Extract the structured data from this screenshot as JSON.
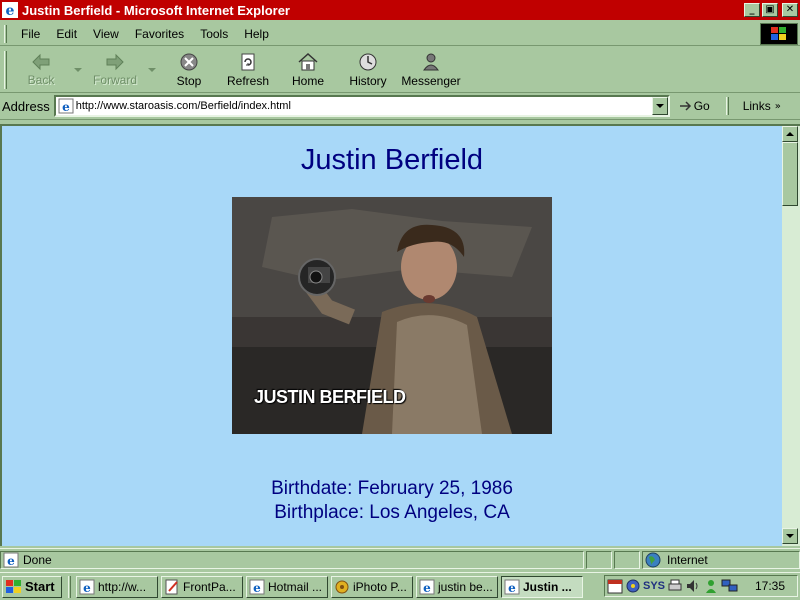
{
  "window": {
    "title": "Justin Berfield - Microsoft Internet Explorer",
    "controls": {
      "minimize": "_",
      "maximize": "▣",
      "close": "✕"
    }
  },
  "menubar": {
    "items": [
      {
        "label": "File"
      },
      {
        "label": "Edit"
      },
      {
        "label": "View"
      },
      {
        "label": "Favorites"
      },
      {
        "label": "Tools"
      },
      {
        "label": "Help"
      }
    ]
  },
  "toolbar": {
    "back": "Back",
    "forward": "Forward",
    "stop": "Stop",
    "refresh": "Refresh",
    "home": "Home",
    "history": "History",
    "messenger": "Messenger"
  },
  "addressbar": {
    "label": "Address",
    "url": "http://www.staroasis.com/Berfield/index.html",
    "go": "Go",
    "links": "Links"
  },
  "page": {
    "heading": "Justin Berfield",
    "photo_caption": "JUSTIN BERFIELD",
    "birthdate": "Birthdate: February 25, 1986",
    "birthplace": "Birthplace: Los Angeles, CA"
  },
  "statusbar": {
    "status": "Done",
    "zone": "Internet"
  },
  "taskbar": {
    "start": "Start",
    "tasks": [
      {
        "label": "http://w...",
        "icon": "ie-icon"
      },
      {
        "label": "FrontPa...",
        "icon": "frontpage-icon"
      },
      {
        "label": "Hotmail ...",
        "icon": "ie-icon"
      },
      {
        "label": "iPhoto P...",
        "icon": "iphoto-icon"
      },
      {
        "label": "justin be...",
        "icon": "ie-icon"
      },
      {
        "label": "Justin ...",
        "icon": "ie-icon",
        "active": true
      }
    ],
    "tray_label": "SYS",
    "clock": "17:35"
  },
  "colors": {
    "titlebar": "#c00000",
    "chrome": "#a8c8a0",
    "page_background": "#a8d8f8",
    "page_text": "#000080"
  }
}
